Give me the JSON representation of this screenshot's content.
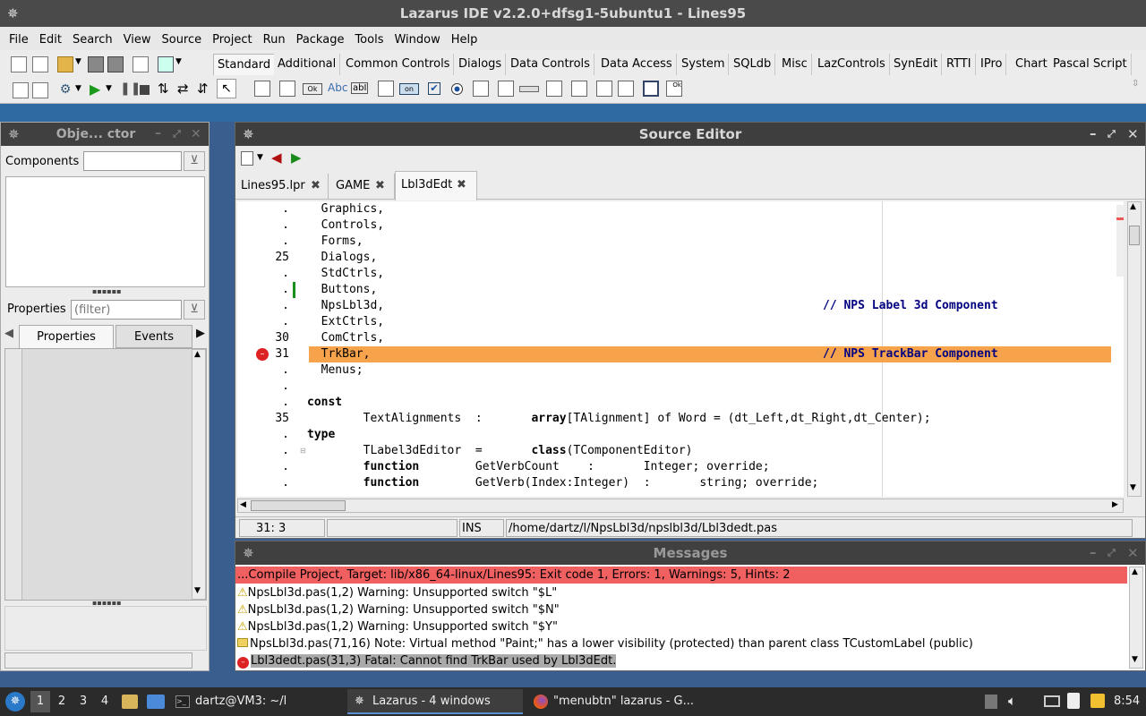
{
  "app": {
    "title": "Lazarus IDE v2.2.0+dfsg1-5ubuntu1 - Lines95"
  },
  "menu": [
    "File",
    "Edit",
    "Search",
    "View",
    "Source",
    "Project",
    "Run",
    "Package",
    "Tools",
    "Window",
    "Help"
  ],
  "palette_tabs": [
    "Standard",
    "Additional",
    "Common Controls",
    "Dialogs",
    "Data Controls",
    "Data Access",
    "System",
    "SQLdb",
    "Misc",
    "LazControls",
    "SynEdit",
    "RTTI",
    "IPro",
    "Chart",
    "Pascal Script"
  ],
  "inspector": {
    "title": "Obje... ctor",
    "components_label": "Components",
    "properties_label": "Properties",
    "filter_placeholder": "(filter)",
    "tab_properties": "Properties",
    "tab_events": "Events"
  },
  "editor": {
    "title": "Source Editor",
    "tabs": [
      "Lines95.lpr",
      "GAME",
      "Lbl3dEdt"
    ],
    "lines": [
      {
        "num": ".",
        "pre": "  Graphics",
        "post": ",",
        "comment": ""
      },
      {
        "num": ".",
        "pre": "  Controls",
        "post": ",",
        "comment": ""
      },
      {
        "num": ".",
        "pre": "  Forms",
        "post": ",",
        "comment": ""
      },
      {
        "num": "25",
        "pre": "  Dialogs",
        "post": ",",
        "comment": ""
      },
      {
        "num": ".",
        "pre": "  StdCtrls",
        "post": ",",
        "comment": ""
      },
      {
        "num": ".",
        "pre": "  Buttons",
        "post": ",",
        "comment": ""
      },
      {
        "num": ".",
        "pre": "  NpsLbl3d",
        "post": ",",
        "comment": "// NPS Label 3d Component"
      },
      {
        "num": ".",
        "pre": "  ExtCtrls",
        "post": ",",
        "comment": ""
      },
      {
        "num": "30",
        "pre": "  ComCtrls",
        "post": ",",
        "comment": ""
      },
      {
        "num": "31",
        "pre": "  TrkBar",
        "post": ",",
        "comment": "// NPS TrackBar Component"
      },
      {
        "num": ".",
        "pre": "  Menus",
        "post": ";",
        "comment": ""
      },
      {
        "num": ".",
        "pre": "",
        "post": "",
        "comment": ""
      },
      {
        "num": ".",
        "pre": "const",
        "post": "",
        "comment": ""
      },
      {
        "num": "35",
        "pre": "        TextAlignments  :       ",
        "kw": "array",
        "post": "[TAlignment] of Word = (dt_Left,dt_Right,dt_Center);",
        "comment": ""
      },
      {
        "num": ".",
        "pre": "type",
        "post": "",
        "comment": ""
      },
      {
        "num": ".",
        "pre": "        TLabel3dEditor  =       ",
        "kw": "class",
        "post": "(TComponentEditor)",
        "comment": ""
      },
      {
        "num": ".",
        "pre": "        ",
        "kw": "function",
        "post": "        GetVerbCount    :       Integer; override;",
        "comment": ""
      },
      {
        "num": ".",
        "pre": "        ",
        "kw": "function",
        "post": "        GetVerb(Index:Integer)  :       string; override;",
        "comment": ""
      }
    ],
    "status": {
      "pos": "31:  3",
      "mode": "INS",
      "file": "/home/dartz/l/NpsLbl3d/npslbl3d/Lbl3dedt.pas"
    }
  },
  "messages": {
    "title": "Messages",
    "summary": "...Compile Project, Target: lib/x86_64-linux/Lines95: Exit code 1, Errors: 1, Warnings: 5, Hints: 2",
    "items": [
      {
        "type": "warning",
        "text": "NpsLbl3d.pas(1,2) Warning: Unsupported switch \"$L\""
      },
      {
        "type": "warning",
        "text": "NpsLbl3d.pas(1,2) Warning: Unsupported switch \"$N\""
      },
      {
        "type": "warning",
        "text": "NpsLbl3d.pas(1,2) Warning: Unsupported switch \"$Y\""
      },
      {
        "type": "note",
        "text": "NpsLbl3d.pas(71,16) Note: Virtual method \"Paint;\" has a lower visibility (protected) than parent class TCustomLabel (public)"
      },
      {
        "type": "fatal",
        "text": "Lbl3dedt.pas(31,3) Fatal: Cannot find TrkBar used by Lbl3dEdt."
      }
    ]
  },
  "taskbar": {
    "workspaces": [
      "1",
      "2",
      "3",
      "4"
    ],
    "terminal": "dartz@VM3: ~/l",
    "lazarus": "Lazarus - 4 windows",
    "firefox": "\"menubtn\" lazarus - G...",
    "clock": "8:54"
  }
}
